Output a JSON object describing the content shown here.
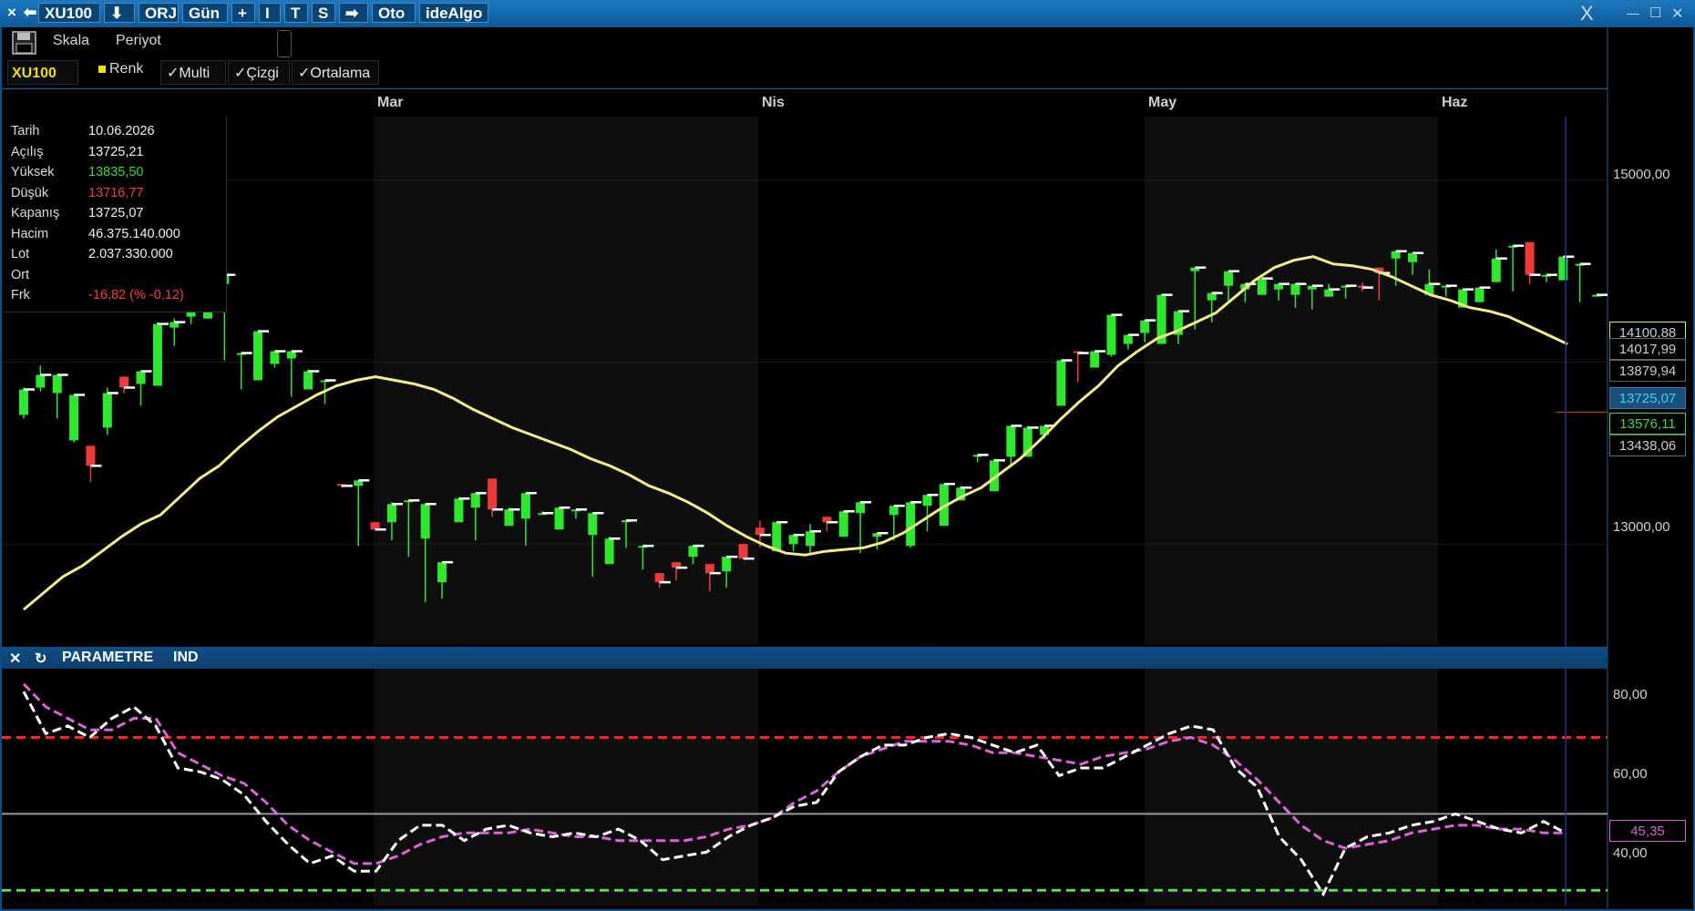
{
  "titlebar": {
    "close_icon": "×",
    "back_icon": "⬅",
    "symbol": "XU100",
    "download_icon": "⬇",
    "orj": "ORJ",
    "period": "Gün",
    "plus": "+",
    "i_label": "I",
    "t_label": "T",
    "s_label": "S",
    "next_icon": "➡",
    "oto": "Oto",
    "brand": "ideAlgo",
    "close_x": "X",
    "minimize": "—",
    "maximize": "☐",
    "win_close": "✕"
  },
  "toolbar": {
    "save_icon": "floppy-disk-icon",
    "skala": "Skala",
    "periyot": "Periyot"
  },
  "filter": {
    "symbol": "XU100",
    "renk": "Renk",
    "multi": "✓Multi",
    "cizgi": "✓Çizgi",
    "ortalama": "✓Ortalama"
  },
  "months": [
    "Mar",
    "Nis",
    "May",
    "Haz"
  ],
  "info": {
    "rows": [
      {
        "k": "Tarih",
        "v": "10.06.2026",
        "color": "#f0f0f0"
      },
      {
        "k": "Açılış",
        "v": "13725,21",
        "color": "#f0f0f0"
      },
      {
        "k": "Yüksek",
        "v": "13835,50",
        "color": "#3bdc3b"
      },
      {
        "k": "Düşük",
        "v": "13716,77",
        "color": "#ff3a3a"
      },
      {
        "k": "Kapanış",
        "v": "13725,07",
        "color": "#f0f0f0"
      },
      {
        "k": "Hacim",
        "v": "46.375.140.000",
        "color": "#f0f0f0"
      },
      {
        "k": "Lot",
        "v": "2.037.330.000",
        "color": "#f0f0f0"
      },
      {
        "k": "Ort",
        "v": "",
        "color": "#f0f0f0"
      },
      {
        "k": "Frk",
        "v": "-16,82 (% -0,12)",
        "color": "#ff3a3a"
      }
    ]
  },
  "price_axis": {
    "ticks": [
      "15000,00",
      "13000,00"
    ],
    "tags": [
      {
        "text": "14100,88",
        "bg": "#000",
        "fg": "#ccc",
        "border": "#f0e060"
      },
      {
        "text": "14017,99",
        "bg": "#000",
        "fg": "#ccc",
        "border": "#666"
      },
      {
        "text": "13879,94",
        "bg": "#000",
        "fg": "#ccc",
        "border": "#666"
      },
      {
        "text": "13725,07",
        "bg": "#1a4f7a",
        "fg": "#40d0ff",
        "border": "#3a7ab0"
      },
      {
        "text": "13576,11",
        "bg": "#000",
        "fg": "#3bdc3b",
        "border": "#3bdc3b"
      },
      {
        "text": "13438,06",
        "bg": "#000",
        "fg": "#ccc",
        "border": "#666"
      }
    ]
  },
  "indicator": {
    "close_icon": "✕",
    "refresh_icon": "↻",
    "param": "PARAMETRE",
    "ind": "IND",
    "ticks": [
      "80,00",
      "60,00",
      "40,00"
    ],
    "value_tag": "45,35",
    "upper_level": 70,
    "mid_level": 50,
    "lower_level": 30
  },
  "colors": {
    "up": "#2ee82e",
    "down": "#f03a3a",
    "ma": "#f5ee84",
    "rsi": "#ffffff",
    "rsi_ma": "#e060e0",
    "upper": "#ff2020",
    "lower": "#50e050"
  },
  "chart_data": {
    "type": "candlestick",
    "ylim": [
      12450,
      15350
    ],
    "last_price": 13725.07,
    "candles": [
      [
        13710,
        13860,
        13690,
        13850
      ],
      [
        13860,
        13980,
        13840,
        13930
      ],
      [
        13830,
        13920,
        13690,
        13930
      ],
      [
        13570,
        13820,
        13560,
        13820
      ],
      [
        13540,
        13510,
        13340,
        13430
      ],
      [
        13640,
        13860,
        13600,
        13830
      ],
      [
        13920,
        13880,
        13830,
        13860
      ],
      [
        13880,
        13800,
        13760,
        13950
      ],
      [
        13870,
        14220,
        13870,
        14210
      ],
      [
        14190,
        14240,
        14090,
        14220
      ],
      [
        14250,
        14210,
        14240,
        14420
      ],
      [
        14240,
        14420,
        14240,
        14420
      ],
      [
        14430,
        14050,
        14010,
        14480
      ],
      [
        14040,
        13870,
        13850,
        14050
      ],
      [
        13900,
        14110,
        14030,
        14170
      ],
      [
        13990,
        14060,
        13970,
        14060
      ],
      [
        14020,
        13900,
        13810,
        14060
      ],
      [
        13850,
        13960,
        13870,
        13950
      ],
      [
        13890,
        13900,
        13770,
        13900
      ],
      [
        13330,
        13330,
        13310,
        13320
      ],
      [
        13320,
        13330,
        12990,
        13350
      ],
      [
        13120,
        13120,
        13120,
        13080
      ],
      [
        13120,
        13230,
        13020,
        13220
      ],
      [
        13230,
        13090,
        12930,
        13240
      ],
      [
        13030,
        12910,
        12680,
        13220
      ],
      [
        12790,
        12890,
        12700,
        12900
      ],
      [
        13120,
        13220,
        13120,
        13250
      ],
      [
        13200,
        13270,
        13020,
        13280
      ],
      [
        13360,
        13170,
        13150,
        13190
      ],
      [
        13100,
        13200,
        13130,
        13190
      ],
      [
        13140,
        13250,
        12990,
        13280
      ],
      [
        13160,
        13180,
        13160,
        13170
      ],
      [
        13080,
        13200,
        13080,
        13200
      ],
      [
        13190,
        13150,
        13140,
        13190
      ],
      [
        13050,
        12820,
        12840,
        13170
      ],
      [
        12890,
        13040,
        13030,
        13030
      ],
      [
        13130,
        13120,
        12980,
        13130
      ],
      [
        12980,
        12890,
        12860,
        12990
      ],
      [
        12840,
        12760,
        12800,
        12790
      ],
      [
        12900,
        12870,
        12800,
        12870
      ],
      [
        12930,
        12960,
        12890,
        12990
      ],
      [
        12890,
        12820,
        12740,
        12840
      ],
      [
        12850,
        12810,
        12760,
        12930
      ],
      [
        13000,
        12930,
        12990,
        12920
      ],
      [
        13090,
        13130,
        12980,
        13050
      ],
      [
        12960,
        13050,
        13000,
        13120
      ],
      [
        13000,
        12990,
        12960,
        13050
      ],
      [
        12990,
        13110,
        12950,
        13070
      ],
      [
        13150,
        13070,
        13090,
        13120
      ],
      [
        13040,
        13160,
        13120,
        13180
      ],
      [
        13170,
        12970,
        12950,
        13230
      ],
      [
        13040,
        13050,
        12970,
        13060
      ],
      [
        13160,
        13020,
        13030,
        13210
      ],
      [
        12990,
        13200,
        12980,
        13230
      ],
      [
        13210,
        13130,
        13070,
        13270
      ],
      [
        13100,
        13300,
        13130,
        13330
      ],
      [
        13240,
        13320,
        13290,
        13310
      ],
      [
        13490,
        13480,
        13450,
        13490
      ],
      [
        13290,
        13470,
        13430,
        13460
      ],
      [
        13480,
        13430,
        13480,
        13650
      ],
      [
        13480,
        13650,
        13580,
        13640
      ],
      [
        13600,
        13640,
        13580,
        13650
      ],
      [
        13760,
        14010,
        13760,
        14010
      ],
      [
        14060,
        13960,
        13890,
        14050
      ],
      [
        13970,
        14050,
        14020,
        14060
      ],
      [
        14040,
        14120,
        14030,
        14260
      ],
      [
        14100,
        14110,
        14070,
        14150
      ],
      [
        14160,
        14220,
        14110,
        14230
      ],
      [
        14100,
        14150,
        14100,
        14370
      ],
      [
        14150,
        14270,
        14100,
        14280
      ],
      [
        14500,
        14230,
        14180,
        14520
      ],
      [
        14340,
        14220,
        14230,
        14380
      ],
      [
        14420,
        14380,
        14330,
        14500
      ],
      [
        14400,
        14380,
        14330,
        14430
      ],
      [
        14370,
        14460,
        14380,
        14460
      ],
      [
        14400,
        14410,
        14340,
        14430
      ],
      [
        14370,
        14300,
        14310,
        14430
      ],
      [
        14400,
        14330,
        14290,
        14420
      ],
      [
        14360,
        14430,
        14390,
        14400
      ],
      [
        14410,
        14380,
        14350,
        14420
      ],
      [
        14420,
        14440,
        14390,
        14410
      ],
      [
        14520,
        14350,
        14340,
        14490
      ],
      [
        14570,
        14420,
        14510,
        14610
      ],
      [
        14550,
        14490,
        14480,
        14600
      ],
      [
        14370,
        14510,
        14430,
        14430
      ],
      [
        14420,
        14360,
        14360,
        14420
      ],
      [
        14300,
        14400,
        14370,
        14400
      ],
      [
        14330,
        14400,
        14360,
        14410
      ],
      [
        14440,
        14620,
        14490,
        14570
      ],
      [
        14630,
        14410,
        14390,
        14640
      ],
      [
        14660,
        14500,
        14430,
        14480
      ],
      [
        14470,
        14480,
        14440,
        14480
      ],
      [
        14450,
        14520,
        14460,
        14580
      ],
      [
        14530,
        14380,
        14330,
        14540
      ],
      [
        14360,
        14360,
        14360,
        14370
      ]
    ],
    "ma_y": [
      12640,
      12730,
      12820,
      12880,
      12960,
      13040,
      13110,
      13160,
      13260,
      13360,
      13430,
      13530,
      13620,
      13700,
      13760,
      13820,
      13870,
      13900,
      13920,
      13900,
      13880,
      13850,
      13800,
      13740,
      13690,
      13640,
      13600,
      13560,
      13520,
      13470,
      13430,
      13380,
      13320,
      13280,
      13230,
      13170,
      13100,
      13040,
      12990,
      12950,
      12940,
      12960,
      12970,
      12980,
      13010,
      13060,
      13130,
      13200,
      13260,
      13310,
      13390,
      13470,
      13570,
      13680,
      13780,
      13870,
      13980,
      14060,
      14130,
      14170,
      14220,
      14270,
      14360,
      14450,
      14520,
      14560,
      14580,
      14540,
      14530,
      14510,
      14470,
      14420,
      14370,
      14340,
      14300,
      14280,
      14250,
      14200,
      14150,
      14100
    ],
    "rsi": [
      82,
      71,
      73,
      70,
      75,
      78,
      73,
      62,
      61,
      59,
      55,
      48,
      42,
      37,
      39,
      35,
      35,
      43,
      47,
      47,
      43,
      46,
      47,
      45,
      44,
      45,
      44,
      46,
      43,
      38,
      39,
      40,
      44,
      47,
      49,
      52,
      53,
      61,
      65,
      68,
      68,
      70,
      71,
      70,
      68,
      66,
      68,
      60,
      62,
      62,
      65,
      68,
      71,
      73,
      72,
      62,
      57,
      44,
      38,
      29,
      41,
      44,
      45,
      47,
      48,
      50,
      48,
      46,
      45,
      48,
      45
    ],
    "rsi_ma": [
      84,
      78,
      75,
      72,
      72,
      75,
      75,
      66,
      63,
      60,
      58,
      53,
      47,
      43,
      40,
      37,
      37,
      39,
      42,
      44,
      45,
      45,
      45,
      46,
      45,
      44,
      44,
      43,
      43,
      43,
      43,
      44,
      46,
      47,
      49,
      53,
      56,
      61,
      65,
      67,
      69,
      69,
      69,
      68,
      66,
      66,
      65,
      64,
      63,
      65,
      66,
      67,
      69,
      70,
      68,
      64,
      59,
      53,
      47,
      43,
      41,
      42,
      43,
      45,
      46,
      47,
      47,
      46,
      46,
      45,
      45
    ]
  }
}
